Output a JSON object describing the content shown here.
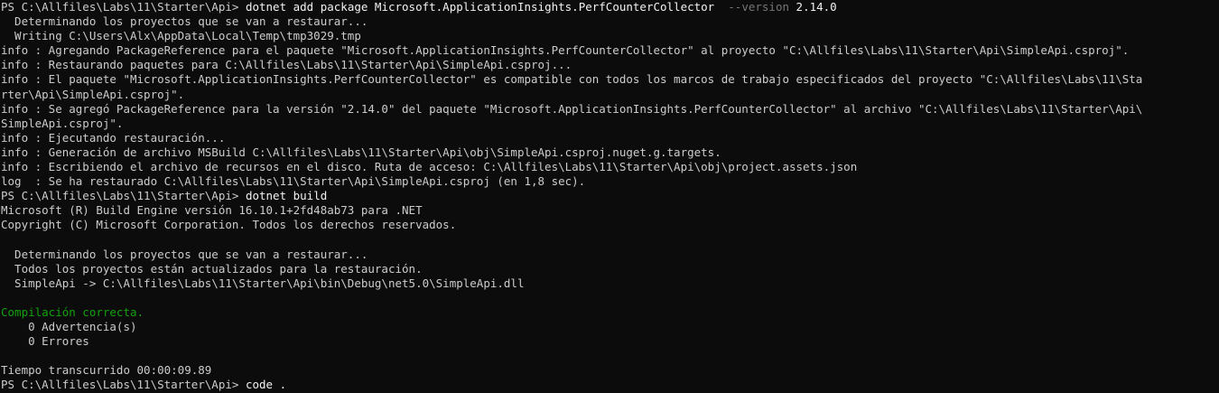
{
  "colors": {
    "background": "#0c0c0c",
    "text": "#cccccc",
    "command": "#f2f2f2",
    "flag": "#767676",
    "success": "#13a10e"
  },
  "terminal": {
    "prompt": "PS C:\\Allfiles\\Labs\\11\\Starter\\Api> ",
    "cmd1": "dotnet add package Microsoft.ApplicationInsights.PerfCounterCollector",
    "cmd1_flag": "  --version",
    "cmd1_version": " 2.14.0",
    "l2": "  Determinando los proyectos que se van a restaurar...",
    "l3": "  Writing C:\\Users\\Alx\\AppData\\Local\\Temp\\tmp3029.tmp",
    "l4": "info : Agregando PackageReference para el paquete \"Microsoft.ApplicationInsights.PerfCounterCollector\" al proyecto \"C:\\Allfiles\\Labs\\11\\Starter\\Api\\SimpleApi.csproj\".",
    "l5": "info : Restaurando paquetes para C:\\Allfiles\\Labs\\11\\Starter\\Api\\SimpleApi.csproj...",
    "l6": "info : El paquete \"Microsoft.ApplicationInsights.PerfCounterCollector\" es compatible con todos los marcos de trabajo especificados del proyecto \"C:\\Allfiles\\Labs\\11\\Sta",
    "l7": "rter\\Api\\SimpleApi.csproj\".",
    "l8": "info : Se agregó PackageReference para la versión \"2.14.0\" del paquete \"Microsoft.ApplicationInsights.PerfCounterCollector\" al archivo \"C:\\Allfiles\\Labs\\11\\Starter\\Api\\",
    "l9": "SimpleApi.csproj\".",
    "l10": "info : Ejecutando restauración...",
    "l11": "info : Generación de archivo MSBuild C:\\Allfiles\\Labs\\11\\Starter\\Api\\obj\\SimpleApi.csproj.nuget.g.targets.",
    "l12": "info : Escribiendo el archivo de recursos en el disco. Ruta de acceso: C:\\Allfiles\\Labs\\11\\Starter\\Api\\obj\\project.assets.json",
    "l13": "log  : Se ha restaurado C:\\Allfiles\\Labs\\11\\Starter\\Api\\SimpleApi.csproj (en 1,8 sec).",
    "cmd2": "dotnet build",
    "l15": "Microsoft (R) Build Engine versión 16.10.1+2fd48ab73 para .NET",
    "l16": "Copyright (C) Microsoft Corporation. Todos los derechos reservados.",
    "l18": "  Determinando los proyectos que se van a restaurar...",
    "l19": "  Todos los proyectos están actualizados para la restauración.",
    "l20": "  SimpleApi -> C:\\Allfiles\\Labs\\11\\Starter\\Api\\bin\\Debug\\net5.0\\SimpleApi.dll",
    "l22": "Compilación correcta.",
    "l23": "    0 Advertencia(s)",
    "l24": "    0 Errores",
    "l26": "Tiempo transcurrido 00:00:09.89",
    "cmd3": "code ."
  }
}
